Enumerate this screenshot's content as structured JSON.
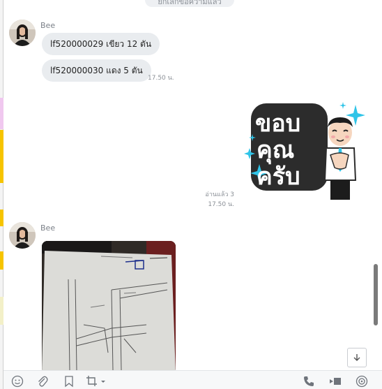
{
  "chat": {
    "system_notice": "ยกเลิกข้อความแล้ว",
    "messages": [
      {
        "sender": "Bee",
        "text": "lf520000029 เขียว 12 ตัน"
      },
      {
        "sender": "",
        "text": "lf520000030 แดง 5 ตัน",
        "time": "17.50 น."
      }
    ],
    "own_sticker": {
      "read_status": "อ่านแล้ว 3",
      "time": "17.50 น.",
      "sticker_text": [
        "ขอบ",
        "คุณ",
        "ครับ"
      ]
    },
    "photo_message": {
      "sender": "Bee"
    }
  },
  "toolbar": {
    "icons": [
      "emoji-icon",
      "attach-icon",
      "bookmark-icon",
      "crop-icon",
      "phone-icon",
      "video-icon",
      "broadcast-icon"
    ]
  },
  "colors": {
    "bubble": "#e9ecef",
    "meta_text": "#8a8f96",
    "sticker_outline": "#2c2c2c",
    "sticker_sparkle": "#2fc4e8"
  }
}
